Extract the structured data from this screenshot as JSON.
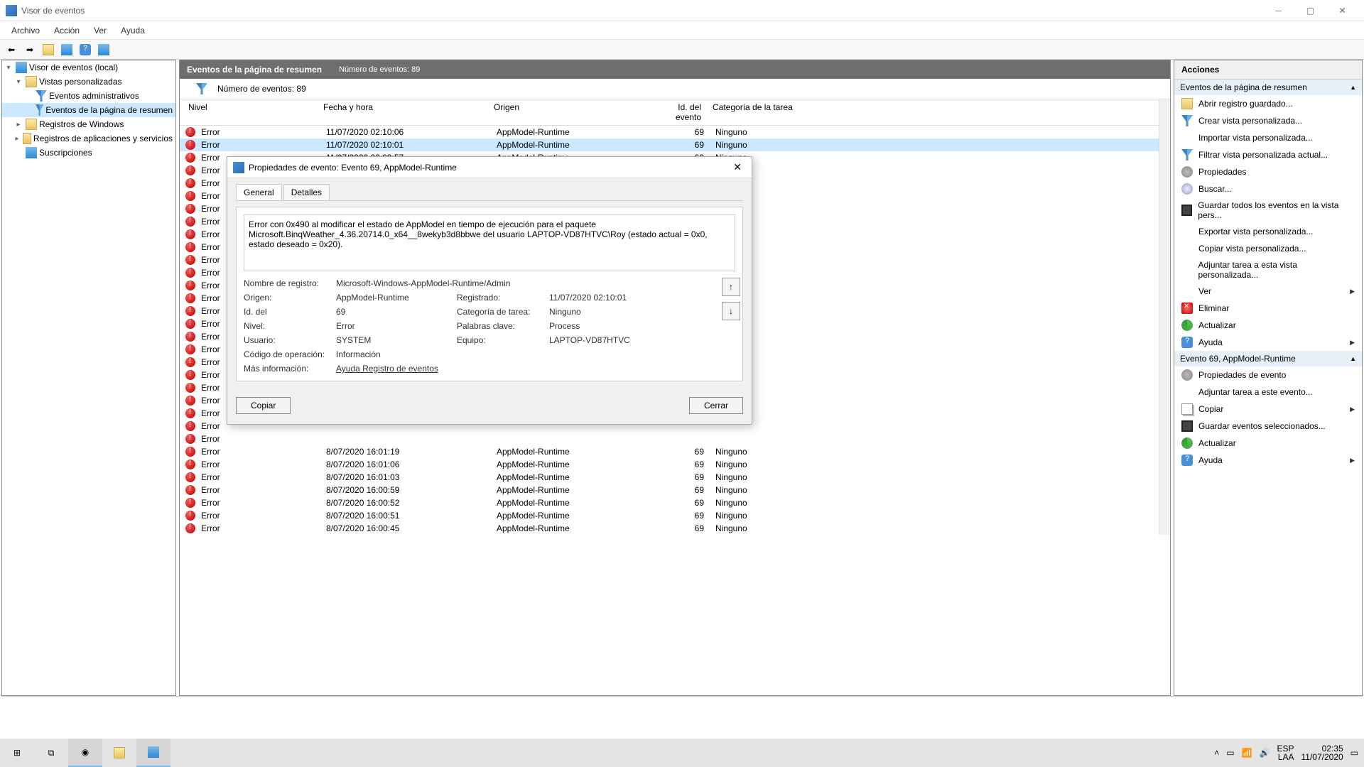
{
  "window": {
    "title": "Visor de eventos"
  },
  "menu": {
    "archivo": "Archivo",
    "accion": "Acción",
    "ver": "Ver",
    "ayuda": "Ayuda"
  },
  "tree": {
    "root": "Visor de eventos (local)",
    "vistas": "Vistas personalizadas",
    "eventos_admin": "Eventos administrativos",
    "eventos_resumen": "Eventos de la página de resumen",
    "registros_win": "Registros de Windows",
    "registros_apps": "Registros de aplicaciones y servicios",
    "suscripciones": "Suscripciones"
  },
  "center": {
    "header_title": "Eventos de la página de resumen",
    "header_count": "Número de eventos: 89",
    "filter_count": "Número de eventos: 89",
    "columns": {
      "nivel": "Nivel",
      "fecha": "Fecha y hora",
      "origen": "Origen",
      "id": "Id. del evento",
      "categoria": "Categoría de la tarea"
    }
  },
  "events": [
    {
      "nivel": "Error",
      "fecha": "11/07/2020 02:10:06",
      "origen": "AppModel-Runtime",
      "id": "69",
      "cat": "Ninguno"
    },
    {
      "nivel": "Error",
      "fecha": "11/07/2020 02:10:01",
      "origen": "AppModel-Runtime",
      "id": "69",
      "cat": "Ninguno"
    },
    {
      "nivel": "Error",
      "fecha": "11/07/2020 02:09:57",
      "origen": "AppModel-Runtime",
      "id": "69",
      "cat": "Ninguno"
    },
    {
      "nivel": "Error",
      "fecha": "",
      "origen": "",
      "id": "",
      "cat": ""
    },
    {
      "nivel": "Error",
      "fecha": "",
      "origen": "",
      "id": "",
      "cat": ""
    },
    {
      "nivel": "Error",
      "fecha": "",
      "origen": "",
      "id": "",
      "cat": ""
    },
    {
      "nivel": "Error",
      "fecha": "",
      "origen": "",
      "id": "",
      "cat": ""
    },
    {
      "nivel": "Error",
      "fecha": "",
      "origen": "",
      "id": "",
      "cat": ""
    },
    {
      "nivel": "Error",
      "fecha": "",
      "origen": "",
      "id": "",
      "cat": ""
    },
    {
      "nivel": "Error",
      "fecha": "",
      "origen": "",
      "id": "",
      "cat": ""
    },
    {
      "nivel": "Error",
      "fecha": "",
      "origen": "",
      "id": "",
      "cat": ""
    },
    {
      "nivel": "Error",
      "fecha": "",
      "origen": "",
      "id": "",
      "cat": ""
    },
    {
      "nivel": "Error",
      "fecha": "",
      "origen": "",
      "id": "",
      "cat": ""
    },
    {
      "nivel": "Error",
      "fecha": "",
      "origen": "",
      "id": "",
      "cat": ""
    },
    {
      "nivel": "Error",
      "fecha": "",
      "origen": "",
      "id": "",
      "cat": ""
    },
    {
      "nivel": "Error",
      "fecha": "",
      "origen": "",
      "id": "",
      "cat": ""
    },
    {
      "nivel": "Error",
      "fecha": "",
      "origen": "",
      "id": "",
      "cat": ""
    },
    {
      "nivel": "Error",
      "fecha": "",
      "origen": "",
      "id": "",
      "cat": ""
    },
    {
      "nivel": "Error",
      "fecha": "",
      "origen": "",
      "id": "",
      "cat": ""
    },
    {
      "nivel": "Error",
      "fecha": "",
      "origen": "",
      "id": "",
      "cat": ""
    },
    {
      "nivel": "Error",
      "fecha": "",
      "origen": "",
      "id": "",
      "cat": ""
    },
    {
      "nivel": "Error",
      "fecha": "",
      "origen": "",
      "id": "",
      "cat": ""
    },
    {
      "nivel": "Error",
      "fecha": "",
      "origen": "",
      "id": "",
      "cat": ""
    },
    {
      "nivel": "Error",
      "fecha": "",
      "origen": "",
      "id": "",
      "cat": ""
    },
    {
      "nivel": "Error",
      "fecha": "",
      "origen": "",
      "id": "",
      "cat": ""
    },
    {
      "nivel": "Error",
      "fecha": "8/07/2020 16:01:19",
      "origen": "AppModel-Runtime",
      "id": "69",
      "cat": "Ninguno"
    },
    {
      "nivel": "Error",
      "fecha": "8/07/2020 16:01:06",
      "origen": "AppModel-Runtime",
      "id": "69",
      "cat": "Ninguno"
    },
    {
      "nivel": "Error",
      "fecha": "8/07/2020 16:01:03",
      "origen": "AppModel-Runtime",
      "id": "69",
      "cat": "Ninguno"
    },
    {
      "nivel": "Error",
      "fecha": "8/07/2020 16:00:59",
      "origen": "AppModel-Runtime",
      "id": "69",
      "cat": "Ninguno"
    },
    {
      "nivel": "Error",
      "fecha": "8/07/2020 16:00:52",
      "origen": "AppModel-Runtime",
      "id": "69",
      "cat": "Ninguno"
    },
    {
      "nivel": "Error",
      "fecha": "8/07/2020 16:00:51",
      "origen": "AppModel-Runtime",
      "id": "69",
      "cat": "Ninguno"
    },
    {
      "nivel": "Error",
      "fecha": "8/07/2020 16:00:45",
      "origen": "AppModel-Runtime",
      "id": "69",
      "cat": "Ninguno"
    }
  ],
  "actions": {
    "header": "Acciones",
    "section1": "Eventos de la página de resumen",
    "items1": [
      "Abrir registro guardado...",
      "Crear vista personalizada...",
      "Importar vista personalizada...",
      "Filtrar vista personalizada actual...",
      "Propiedades",
      "Buscar...",
      "Guardar todos los eventos en la vista pers...",
      "Exportar vista personalizada...",
      "Copiar vista personalizada...",
      "Adjuntar tarea a esta vista personalizada...",
      "Ver",
      "Eliminar",
      "Actualizar",
      "Ayuda"
    ],
    "section2": "Evento 69, AppModel-Runtime",
    "items2": [
      "Propiedades de evento",
      "Adjuntar tarea a este evento...",
      "Copiar",
      "Guardar eventos seleccionados...",
      "Actualizar",
      "Ayuda"
    ]
  },
  "dialog": {
    "title": "Propiedades de evento: Evento 69, AppModel-Runtime",
    "tab_general": "General",
    "tab_detalles": "Detalles",
    "description": "Error con 0x490 al modificar el estado de AppModel en tiempo de ejecución para el paquete Microsoft.BinqWeather_4.36.20714.0_x64__8wekyb3d8bbwe del usuario LAPTOP-VD87HTVC\\Roy (estado actual = 0x0, estado deseado = 0x20).",
    "labels": {
      "nombre": "Nombre de registro:",
      "origen": "Origen:",
      "registrado": "Registrado:",
      "id": "Id. del",
      "categoria": "Categoría de tarea:",
      "nivel": "Nivel:",
      "palabras": "Palabras clave:",
      "usuario": "Usuario:",
      "equipo": "Equipo:",
      "codigo": "Código de operación:",
      "mas": "Más información:"
    },
    "values": {
      "nombre": "Microsoft-Windows-AppModel-Runtime/Admin",
      "origen": "AppModel-Runtime",
      "registrado": "11/07/2020 02:10:01",
      "id": "69",
      "categoria": "Ninguno",
      "nivel": "Error",
      "palabras": "Process",
      "usuario": "SYSTEM",
      "equipo": "LAPTOP-VD87HTVC",
      "codigo": "Información",
      "mas": "Ayuda Registro de eventos"
    },
    "copiar": "Copiar",
    "cerrar": "Cerrar"
  },
  "taskbar": {
    "lang1": "ESP",
    "lang2": "LAA",
    "time": "02:35",
    "date": "11/07/2020"
  }
}
